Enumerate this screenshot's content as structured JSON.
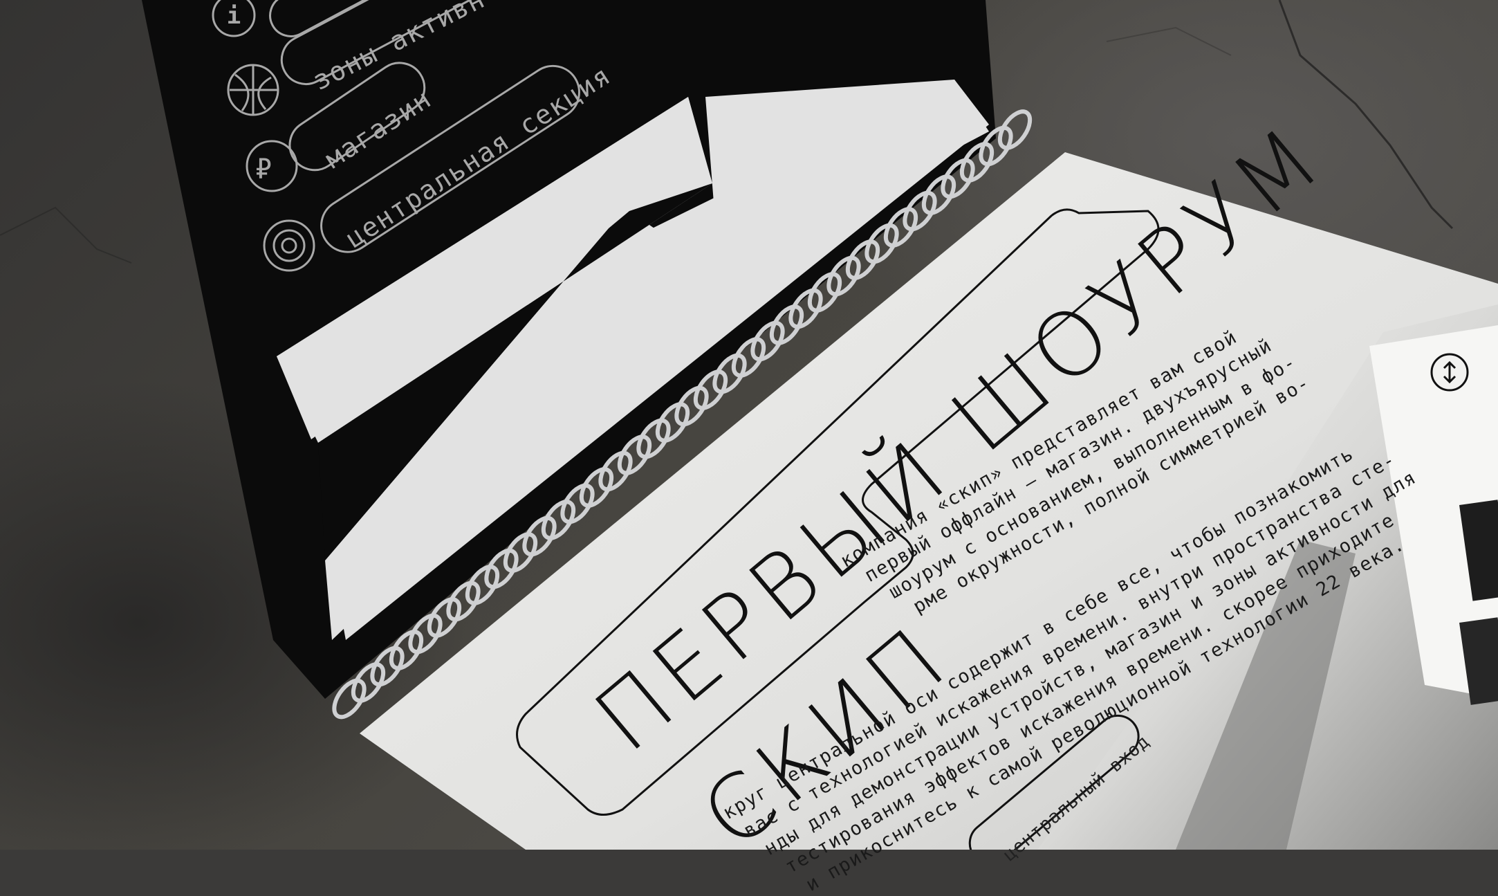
{
  "brochure": {
    "nav_items": [
      {
        "icon": "info-icon",
        "label": "i"
      },
      {
        "icon": "basketball-icon",
        "label": "зоны активн"
      },
      {
        "icon": "ruble-icon",
        "label": "магазин"
      },
      {
        "icon": "target-icon",
        "label": "центральная секция"
      }
    ],
    "title_line_1": "ПЕРВЫЙ ШОУРУМ",
    "title_line_2": "СКИП",
    "body_lines": [
      "компания «скип» представляет вам свой",
      "первый оффлайн — магазин. двухъярусный",
      "шоурум с основанием, выполненным в фо-",
      "рме окружности, полной  симметрией во-",
      "круг центральной оси содержит в себе все, чтобы познакомить",
      "вас с технологией искажения времени. внутри пространства сте-",
      "нды для демонстрации устройств, магазин и зоны активности для",
      "тестирования  эффектов  искажения  времени.  скорее  приходите",
      "и прикоснитесь к самой революционной технологии 22 века."
    ],
    "entrance_label": "центральный вход",
    "colors": {
      "page_black": "#0b0b0b",
      "paper": "#e6e6e4",
      "shape_white": "#e2e2e2",
      "ink": "#111111"
    }
  }
}
